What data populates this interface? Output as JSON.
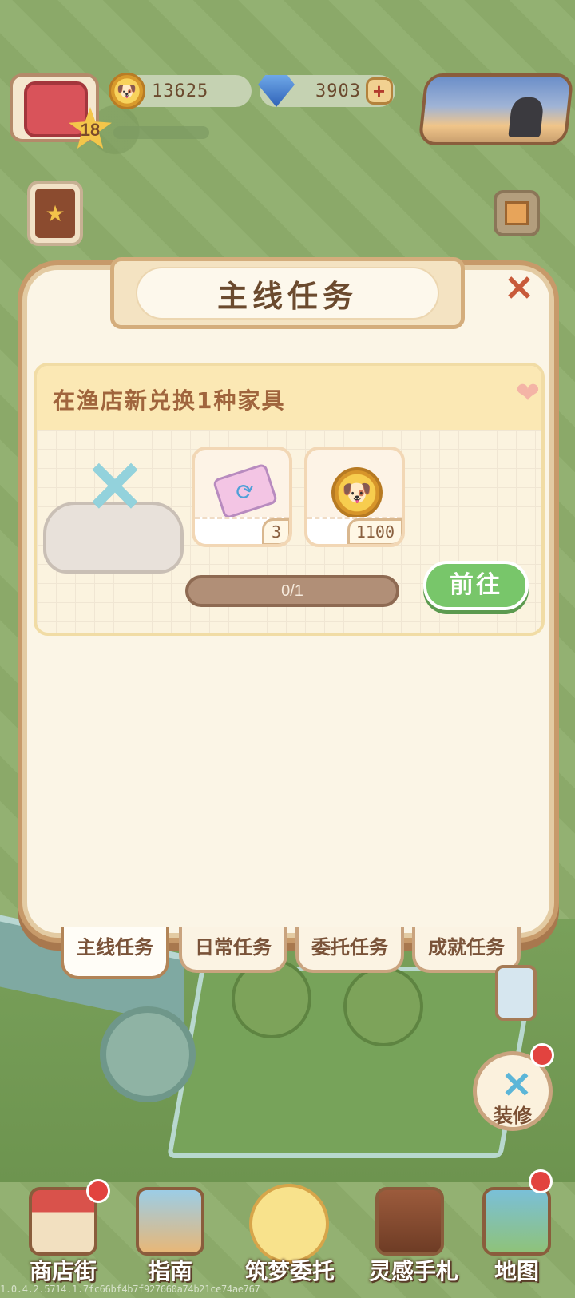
{
  "hud": {
    "level": "18",
    "coins": "13625",
    "gems": "3903",
    "plus_symbol": "+",
    "coin_icon": "corgi-coin-icon",
    "gem_icon": "diamond-icon"
  },
  "panel": {
    "title": "主线任务",
    "close_symbol": "✕"
  },
  "task": {
    "description": "在渔店新兑换1种家具",
    "rewards": [
      {
        "icon": "ticket-icon",
        "qty": "3"
      },
      {
        "icon": "corgi-coin-icon",
        "qty": "1100"
      }
    ],
    "progress": "0/1",
    "progress_fraction": 0,
    "go_label": "前往"
  },
  "tabs": [
    {
      "label": "主线任务",
      "active": true
    },
    {
      "label": "日常任务",
      "active": false
    },
    {
      "label": "委托任务",
      "active": false
    },
    {
      "label": "成就任务",
      "active": false
    }
  ],
  "decorate": {
    "label": "装修"
  },
  "nav": [
    {
      "label": "商店街",
      "icon": "shop-icon",
      "badge": true
    },
    {
      "label": "指南",
      "icon": "guide-icon",
      "badge": false
    },
    {
      "label": "筑梦委托",
      "icon": "notebook-icon",
      "badge": false
    },
    {
      "label": "灵感手札",
      "icon": "quill-book-icon",
      "badge": false
    },
    {
      "label": "地图",
      "icon": "map-icon",
      "badge": true
    }
  ],
  "version": "1.0.4.2.5714.1.7fc66bf4b7f927660a74b21ce74ae767",
  "colors": {
    "accent_green": "#78c66a",
    "panel_bg": "#fbf5e6",
    "badge_red": "#e2433f",
    "text_brown": "#6b4a2e"
  }
}
